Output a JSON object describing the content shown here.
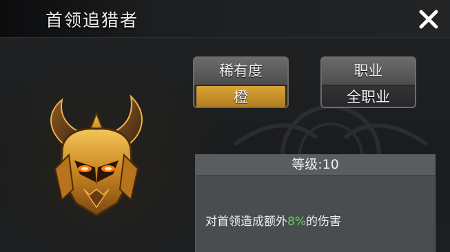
{
  "window": {
    "title": "首领追猎者",
    "close_icon": "close-icon"
  },
  "item": {
    "icon": "demon-helmet-icon"
  },
  "rarity": {
    "label": "稀有度",
    "value": "橙",
    "color": "#c8912a"
  },
  "job": {
    "label": "职业",
    "value": "全职业"
  },
  "detail": {
    "level_text": "等级:10",
    "desc_prefix": "对首领造成额外",
    "desc_value": "8%",
    "desc_suffix": "的伤害",
    "highlight_color": "#5fd35a"
  }
}
